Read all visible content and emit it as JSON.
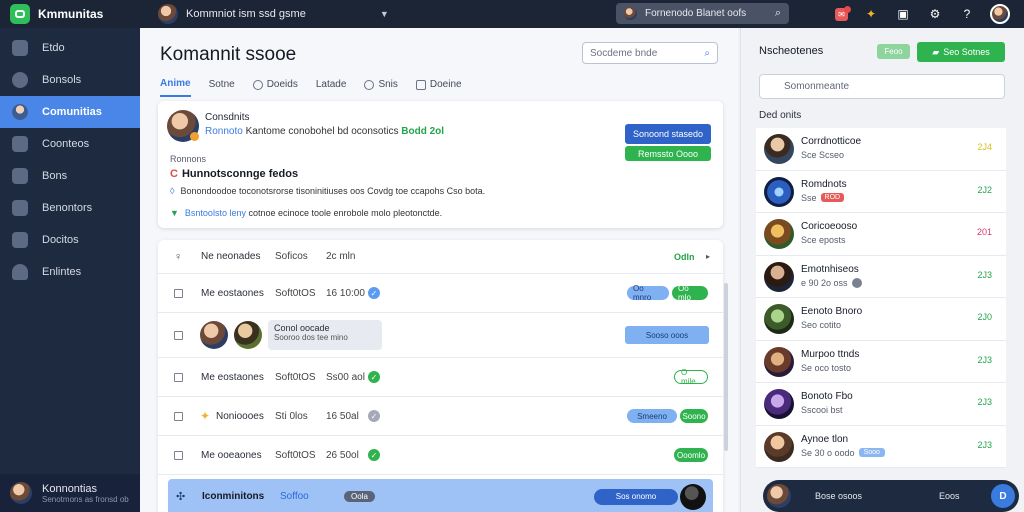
{
  "app": {
    "title": "Kmmunitas"
  },
  "account": {
    "name": "Kommniot ism ssd gsme"
  },
  "top_search": {
    "text": "Fornenodo Blanet oofs"
  },
  "sidebar": {
    "items": [
      {
        "label": "Etdo",
        "active": false
      },
      {
        "label": "Bonsols",
        "active": false
      },
      {
        "label": "Comunitias",
        "active": true
      },
      {
        "label": "Coonteos",
        "active": false
      },
      {
        "label": "Bons",
        "active": false
      },
      {
        "label": "Benontors",
        "active": false
      },
      {
        "label": "Docitos",
        "active": false
      },
      {
        "label": "Enlintes",
        "active": false
      }
    ],
    "user": {
      "name": "Konnontias",
      "sub": "Senotmons as fronsd ob"
    }
  },
  "main": {
    "title": "Komannit ssooe",
    "search_placeholder": "Socdeme bnde",
    "tabs": [
      "Anime",
      "Sotne",
      "Doeids",
      "Latade",
      "Snis",
      "Doeine"
    ],
    "post": {
      "name": "Consdnits",
      "sub_link": "Ronnoto",
      "sub_text": "Kantome conobohel bd oconsotics",
      "sub_badge": "Bodd 2ol",
      "button_primary": "Sonoond stasedo",
      "button_secondary": "Remssto Oooo",
      "label": "Ronnons",
      "heading": "Hunnotsconnge fedos",
      "line1": "Bonondoodoe toconotsrorse tisoninitiuses oos Covdg toe ccapohs Cso bota.",
      "line2_link": "Bsntoolsto leny",
      "line2_rest": "cotnoe ecinoce toole enrobole molo pleotonctde."
    },
    "rows": [
      {
        "c1": "Ne neonades",
        "c2": "Soficos",
        "c3": "2c mln",
        "status": "Odln"
      },
      {
        "c1": "Me eostaones",
        "c2": "Soft0tOS",
        "c3": "16 10:00",
        "pill1": "Oo mnro",
        "pill2": "Oo mlo"
      },
      {
        "chip_title": "Conol oocade",
        "chip_sub": "Sooroo dos tee mino",
        "pill1": "Sooso ooos"
      },
      {
        "c1": "Me eostaones",
        "c2": "Soft0tOS",
        "c3": "Ss00 aol",
        "pill2": "O mile"
      },
      {
        "c1": "Nonioooes",
        "c2": "Sti 0los",
        "c3": "16 50al",
        "pill1": "Smeeno",
        "pill2": "Soono"
      },
      {
        "c1": "Me ooeaones",
        "c2": "Soft0tOS",
        "c3": "26 50ol",
        "pill2": "Ooomlo"
      },
      {
        "c1": "Iconminitons",
        "c2": "Soffoo",
        "c3": "Oola",
        "pill1": "Sos onomo"
      }
    ]
  },
  "right": {
    "title": "Nscheotenes",
    "pill": "Feoo",
    "button": "Seo Sotnes",
    "search_placeholder": "Somonmeante",
    "sub": "Ded onits",
    "contacts": [
      {
        "name": "Corrdnotticoe",
        "status": "Sce Scseo",
        "count": "2J4",
        "count_color": "#d4c21a"
      },
      {
        "name": "Romdnots",
        "status": "Sse",
        "tag": "ROD",
        "count": "2J2",
        "count_color": "#22a44a"
      },
      {
        "name": "Coricoeooso",
        "status": "Sce eposts",
        "count": "201",
        "count_color": "#d43a6a"
      },
      {
        "name": "Emotnhiseos",
        "status": "e 90 2o oss",
        "count": "2J3",
        "count_color": "#22a44a"
      },
      {
        "name": "Eenoto Bnoro",
        "status": "Seo cotito",
        "count": "2J0",
        "count_color": "#22a44a"
      },
      {
        "name": "Murpoo ttnds",
        "status": "Se oco tosto",
        "count": "2J3",
        "count_color": "#22a44a"
      },
      {
        "name": "Bonoto Fbo",
        "status": "Sscooi bst",
        "count": "2J3",
        "count_color": "#22a44a"
      },
      {
        "name": "Aynoe tlon",
        "status": "Se 30 o oodo",
        "tag": "Sooo",
        "count": "2J3",
        "count_color": "#22a44a"
      }
    ],
    "chat": {
      "left": "Bose osoos",
      "right": "Eoos",
      "send": "D"
    }
  }
}
